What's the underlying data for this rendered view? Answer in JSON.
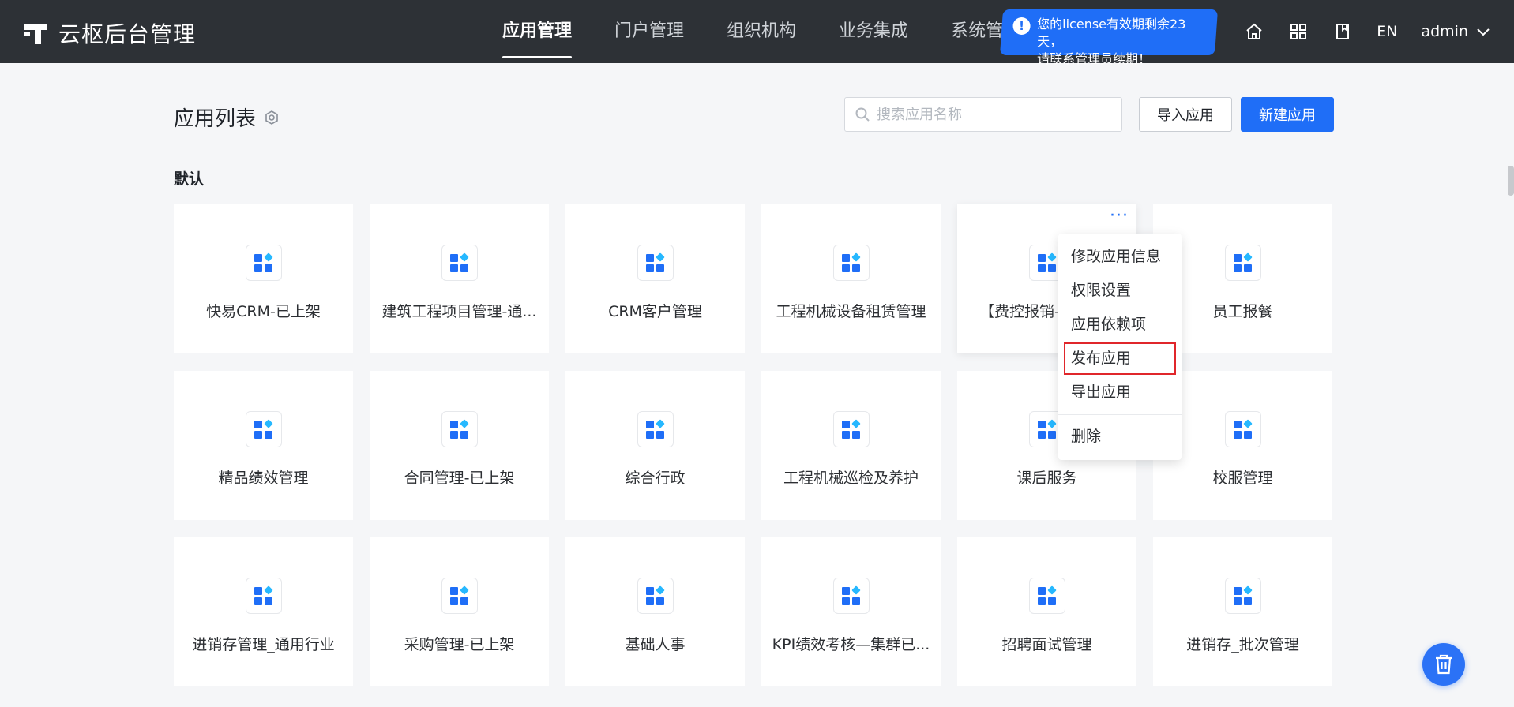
{
  "app": {
    "title": "云枢后台管理"
  },
  "nav": {
    "items": [
      {
        "label": "应用管理",
        "active": true
      },
      {
        "label": "门户管理",
        "active": false
      },
      {
        "label": "组织机构",
        "active": false
      },
      {
        "label": "业务集成",
        "active": false
      },
      {
        "label": "系统管理",
        "active": false
      }
    ]
  },
  "license": {
    "line1": "您的license有效期剩余23天，",
    "line2": "请联系管理员续期！",
    "icon": "exclamation-icon"
  },
  "top_right": {
    "icons": [
      "home-icon",
      "grid-apps-icon",
      "book-icon"
    ],
    "lang": "EN",
    "user": "admin"
  },
  "page": {
    "title": "应用列表",
    "title_icon": "settings-hexagon-icon",
    "search_placeholder": "搜索应用名称",
    "import_label": "导入应用",
    "new_label": "新建应用",
    "group_title": "默认"
  },
  "apps": [
    "快易CRM-已上架",
    "建筑工程项目管理-通...",
    "CRM客户管理",
    "工程机械设备租赁管理",
    "【费控报销-",
    "员工报餐",
    "精品绩效管理",
    "合同管理-已上架",
    "综合行政",
    "工程机械巡检及养护",
    "课后服务",
    "校服管理",
    "进销存管理_通用行业",
    "采购管理-已上架",
    "基础人事",
    "KPI绩效考核—集群已...",
    "招聘面试管理",
    "进销存_批次管理"
  ],
  "more_label": "···",
  "menu": {
    "items": [
      {
        "label": "修改应用信息"
      },
      {
        "label": "权限设置"
      },
      {
        "label": "应用依赖项"
      },
      {
        "label": "发布应用",
        "highlighted": true
      },
      {
        "label": "导出应用"
      },
      {
        "label": "删除"
      }
    ]
  },
  "colors": {
    "primary": "#1f6ef7",
    "topbar": "#2d3136",
    "highlight_border": "#e0262b"
  }
}
